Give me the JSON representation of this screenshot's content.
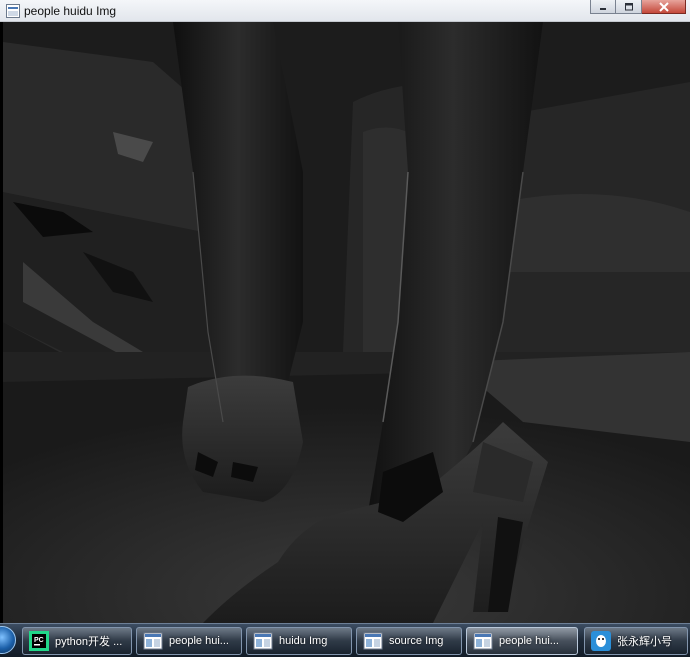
{
  "window": {
    "title": "people huidu Img",
    "icon": "app-window-icon",
    "controls": [
      "minimize-icon",
      "maximize-icon",
      "close-icon"
    ]
  },
  "canvas": {
    "description_icon": "image-canvas",
    "dominant_color": "#141414"
  },
  "taskbar": {
    "start_icon": "windows-start-orb",
    "items": [
      {
        "label": "python开发 ...",
        "icon": "pycharm-icon",
        "active": false
      },
      {
        "label": "people hui...",
        "icon": "image-window-icon",
        "active": false
      },
      {
        "label": "huidu Img",
        "icon": "image-window-icon",
        "active": false
      },
      {
        "label": "source Img",
        "icon": "image-window-icon",
        "active": false
      },
      {
        "label": "people hui...",
        "icon": "image-window-icon",
        "active": true
      },
      {
        "label": "张永辉小号",
        "icon": "qq-icon",
        "active": false
      }
    ]
  },
  "colors": {
    "taskbar": "#1f2b3a",
    "titlebar": "#e2e6ec",
    "close_button": "#c4483a"
  }
}
